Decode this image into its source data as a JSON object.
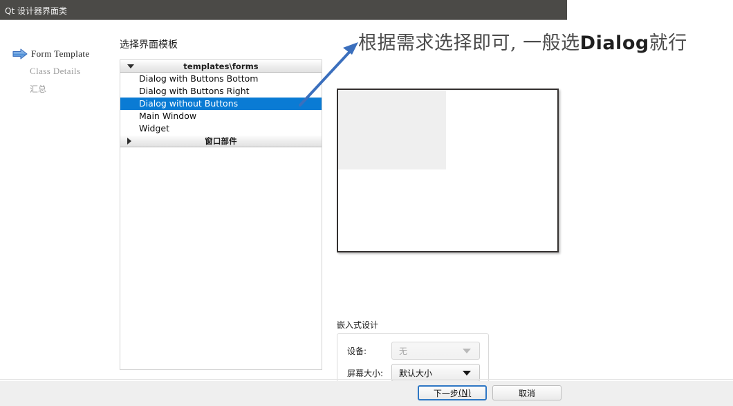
{
  "window": {
    "title": "Qt 设计器界面类"
  },
  "sidebar": {
    "items": [
      {
        "label": "Form Template",
        "state": "active",
        "icon": "arrow-right-icon"
      },
      {
        "label": "Class Details",
        "state": "inactive"
      },
      {
        "label": "汇总",
        "state": "inactive"
      }
    ]
  },
  "main": {
    "heading": "选择界面模板",
    "tree": {
      "groups": [
        {
          "label": "templates\\forms",
          "expanded": true,
          "items": [
            {
              "label": "Dialog with Buttons Bottom",
              "selected": false
            },
            {
              "label": "Dialog with Buttons Right",
              "selected": false
            },
            {
              "label": "Dialog without Buttons",
              "selected": true
            },
            {
              "label": "Main Window",
              "selected": false
            },
            {
              "label": "Widget",
              "selected": false
            }
          ]
        },
        {
          "label": "窗口部件",
          "expanded": false,
          "items": []
        }
      ]
    },
    "preview": {
      "alt": "Dialog without Buttons preview"
    },
    "embedded_design": {
      "title": "嵌入式设计",
      "fields": [
        {
          "label": "设备:",
          "value": "无",
          "disabled": true
        },
        {
          "label": "屏幕大小:",
          "value": "默认大小",
          "disabled": false
        }
      ]
    }
  },
  "annotation": {
    "text_before": "根据需求选择即可, 一般选",
    "text_emphasis": "Dialog",
    "text_after": "就行",
    "arrow_color": "#3b6fbd"
  },
  "footer": {
    "buttons": [
      {
        "label": "下一步",
        "mnemonic": "(N)",
        "kind": "primary"
      },
      {
        "label": "取消",
        "mnemonic": "",
        "kind": "secondary"
      }
    ]
  },
  "colors": {
    "titlebar_bg": "#4b4a47",
    "selection_blue": "#0a7bd4",
    "accent_blue": "#2e77c4",
    "footer_bg": "#efefef"
  }
}
